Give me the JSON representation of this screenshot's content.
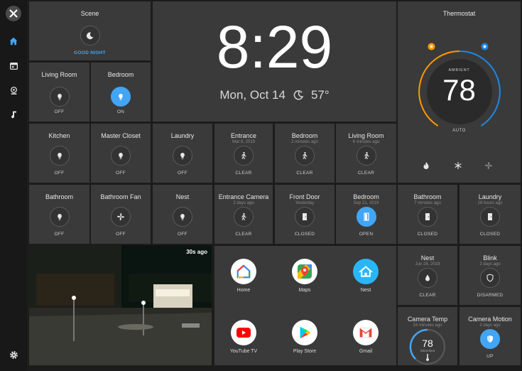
{
  "scene": {
    "title": "Scene",
    "state": "GOOD NIGHT"
  },
  "clock": {
    "time": "8:29",
    "date": "Mon, Oct 14",
    "temp": "57°"
  },
  "thermostat": {
    "title": "Thermostat",
    "label": "AMBIENT",
    "temp": "78",
    "mode": "AUTO"
  },
  "tiles": {
    "living_room": {
      "title": "Living Room",
      "state": "OFF"
    },
    "bedroom_light": {
      "title": "Bedroom",
      "state": "ON"
    },
    "kitchen": {
      "title": "Kitchen",
      "state": "OFF"
    },
    "master_closet": {
      "title": "Master Closet",
      "state": "OFF"
    },
    "laundry_light": {
      "title": "Laundry",
      "state": "OFF"
    },
    "entrance": {
      "title": "Entrance",
      "sub": "Mar 6, 2019",
      "state": "CLEAR"
    },
    "bedroom_motion": {
      "title": "Bedroom",
      "sub": "2 minutes ago",
      "state": "CLEAR"
    },
    "living_motion": {
      "title": "Living Room",
      "sub": "6 minutes ago",
      "state": "CLEAR"
    },
    "bathroom": {
      "title": "Bathroom",
      "state": "OFF"
    },
    "bathroom_fan": {
      "title": "Bathroom Fan",
      "state": "OFF"
    },
    "nest_light": {
      "title": "Nest",
      "state": "OFF"
    },
    "entrance_camera": {
      "title": "Entrance Camera",
      "sub": "2 days ago",
      "state": "CLEAR"
    },
    "front_door": {
      "title": "Front Door",
      "sub": "Yesterday",
      "state": "CLOSED"
    },
    "bedroom_door": {
      "title": "Bedroom",
      "sub": "Sep 21, 2019",
      "state": "OPEN"
    },
    "bathroom_door": {
      "title": "Bathroom",
      "sub": "7 minutes ago",
      "state": "CLOSED"
    },
    "laundry_door": {
      "title": "Laundry",
      "sub": "16 hours ago",
      "state": "CLOSED"
    },
    "nest_smoke": {
      "title": "Nest",
      "sub": "Jun 28, 2019",
      "state": "CLEAR"
    },
    "blink": {
      "title": "Blink",
      "sub": "2 days ago",
      "state": "DISARMED"
    },
    "camera_temp": {
      "title": "Camera Temp",
      "sub": "24 minutes ago",
      "value": "78",
      "unit": "fahrenheit"
    },
    "camera_motion": {
      "title": "Camera Motion",
      "sub": "2 days ago",
      "state": "UP"
    }
  },
  "camera": {
    "timestamp": "30s ago"
  },
  "apps": [
    {
      "label": "Home"
    },
    {
      "label": "Maps"
    },
    {
      "label": "Nest"
    },
    {
      "label": "YouTube TV"
    },
    {
      "label": "Play Store"
    },
    {
      "label": "Gmail"
    }
  ],
  "icons": {
    "close": "close-icon",
    "home": "home-icon",
    "calendar": "calendar-icon",
    "webcam": "webcam-icon",
    "music": "music-icon",
    "settings": "gear-icon",
    "moon": "moon-icon",
    "bulb": "lightbulb-icon",
    "walk": "walking-icon",
    "door": "door-icon",
    "fan": "fan-icon",
    "drop": "drop-icon",
    "shield": "shield-icon",
    "flame": "flame-icon",
    "snow": "snowflake-icon"
  },
  "colors": {
    "accent": "#42a5f5",
    "heat": "#ff9800",
    "cool": "#1e88e5",
    "tile": "#3a3a3a",
    "background": "#1c1c1c"
  }
}
